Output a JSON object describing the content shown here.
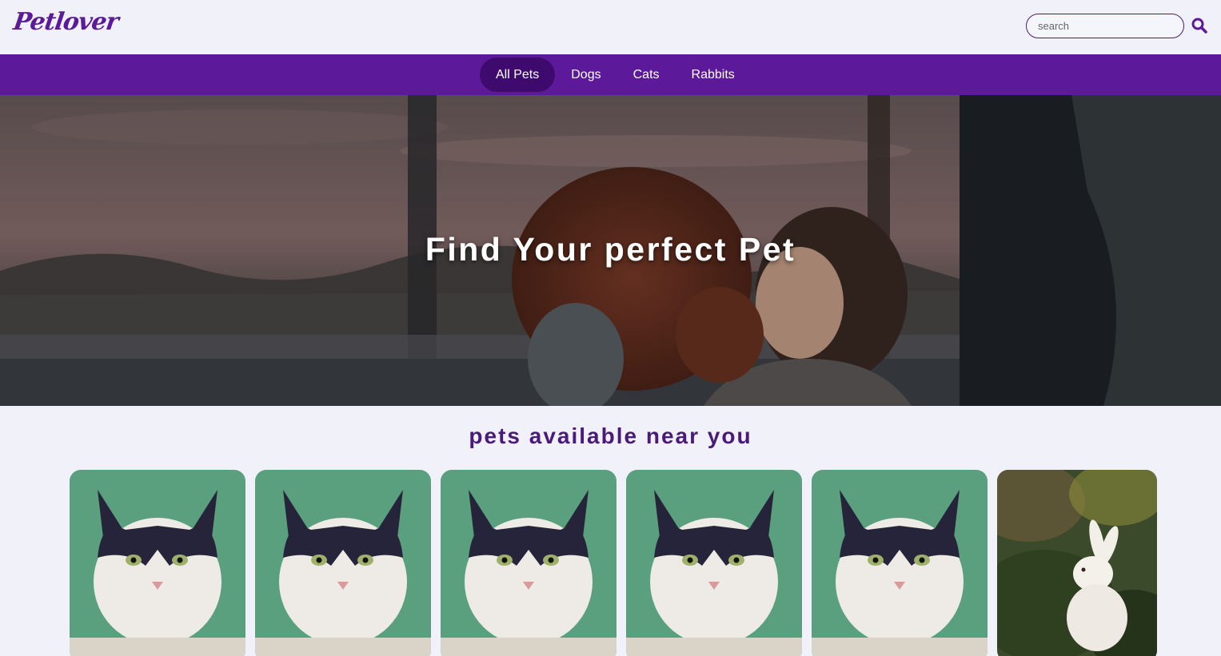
{
  "header": {
    "logo_text": "Petlover",
    "search_placeholder": "search",
    "search_value": ""
  },
  "nav": {
    "items": [
      {
        "label": "All Pets",
        "active": true
      },
      {
        "label": "Dogs",
        "active": false
      },
      {
        "label": "Cats",
        "active": false
      },
      {
        "label": "Rabbits",
        "active": false
      }
    ]
  },
  "hero": {
    "title": "Find Your perfect Pet"
  },
  "section": {
    "title": "pets available near you"
  },
  "cards": [
    {
      "kind": "cat"
    },
    {
      "kind": "cat"
    },
    {
      "kind": "cat"
    },
    {
      "kind": "cat"
    },
    {
      "kind": "cat"
    },
    {
      "kind": "rabbit"
    }
  ],
  "colors": {
    "brand": "#5c1a9a",
    "nav_active": "#3e0a6e",
    "page_bg": "#f1f1f9",
    "cat_bg": "#5aa07e",
    "rabbit_bg": "#3a4a2a"
  },
  "icons": {
    "search": "search-icon"
  }
}
